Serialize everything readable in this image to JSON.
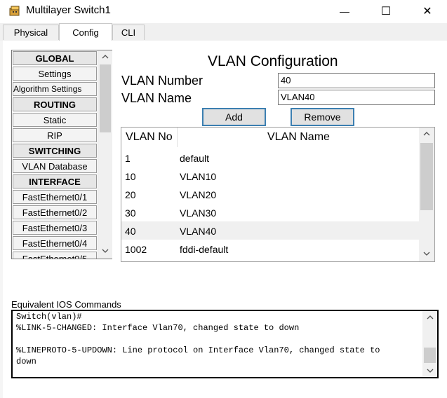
{
  "window": {
    "title": "Multilayer Switch1",
    "controls": {
      "minimize": "—",
      "maximize": "☐",
      "close": "✕"
    }
  },
  "tabs": [
    {
      "label": "Physical",
      "active": false
    },
    {
      "label": "Config",
      "active": true
    },
    {
      "label": "CLI",
      "active": false
    }
  ],
  "nav": {
    "items": [
      {
        "label": "GLOBAL",
        "type": "header"
      },
      {
        "label": "Settings",
        "type": "item"
      },
      {
        "label": "Algorithm Settings",
        "type": "item"
      },
      {
        "label": "ROUTING",
        "type": "header"
      },
      {
        "label": "Static",
        "type": "item"
      },
      {
        "label": "RIP",
        "type": "item"
      },
      {
        "label": "SWITCHING",
        "type": "header"
      },
      {
        "label": "VLAN Database",
        "type": "item"
      },
      {
        "label": "INTERFACE",
        "type": "header"
      },
      {
        "label": "FastEthernet0/1",
        "type": "item"
      },
      {
        "label": "FastEthernet0/2",
        "type": "item"
      },
      {
        "label": "FastEthernet0/3",
        "type": "item"
      },
      {
        "label": "FastEthernet0/4",
        "type": "item"
      },
      {
        "label": "FastEthernet0/5",
        "type": "item"
      }
    ]
  },
  "vlan_config": {
    "title": "VLAN Configuration",
    "number_label": "VLAN Number",
    "number_value": "40",
    "name_label": "VLAN Name",
    "name_value": "VLAN40",
    "add_label": "Add",
    "remove_label": "Remove",
    "table": {
      "headers": [
        "VLAN No",
        "VLAN Name"
      ],
      "rows": [
        {
          "no": "1",
          "name": "default"
        },
        {
          "no": "10",
          "name": "VLAN10"
        },
        {
          "no": "20",
          "name": "VLAN20"
        },
        {
          "no": "30",
          "name": "VLAN30"
        },
        {
          "no": "40",
          "name": "VLAN40",
          "selected": true
        },
        {
          "no": "1002",
          "name": "fddi-default"
        }
      ]
    }
  },
  "ios": {
    "label": "Equivalent IOS Commands",
    "lines": [
      "Switch(vlan)#",
      "%LINK-5-CHANGED: Interface Vlan70, changed state to down",
      "",
      "%LINEPROTO-5-UPDOWN: Line protocol on Interface Vlan70, changed state to",
      "down"
    ]
  },
  "colors": {
    "button_border": "#3c7fb1",
    "selected_row": "#f0f0f0"
  }
}
